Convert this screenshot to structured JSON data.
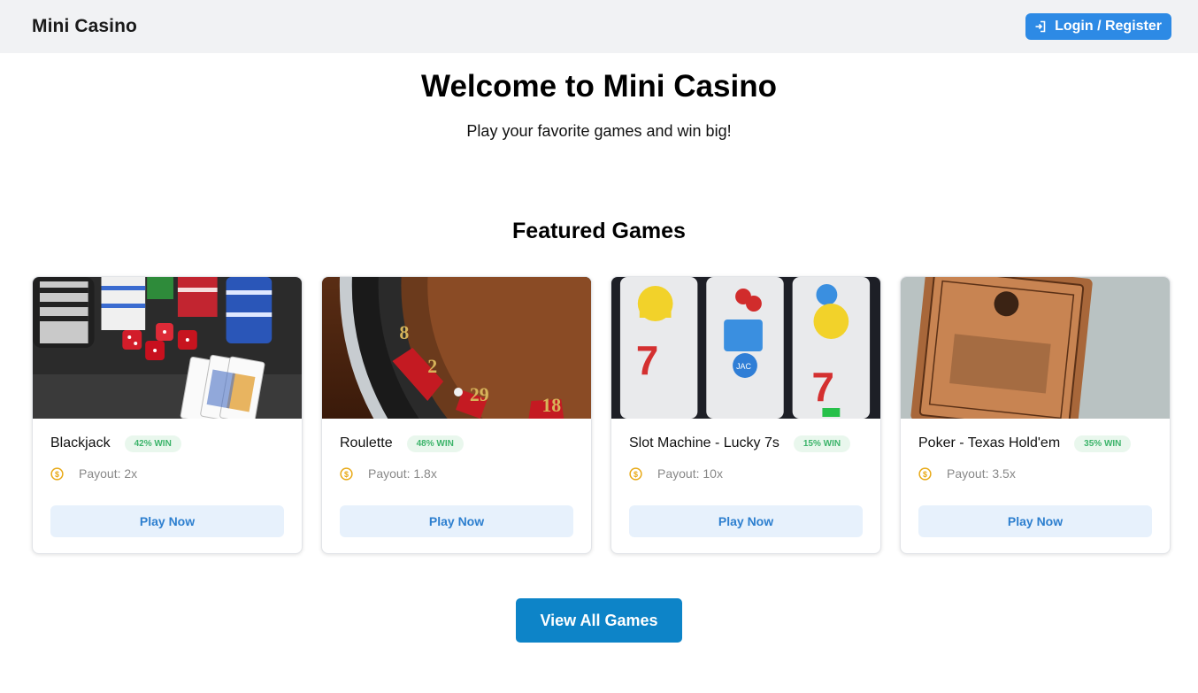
{
  "header": {
    "brand": "Mini Casino",
    "login_label": "Login / Register"
  },
  "hero": {
    "title": "Welcome to Mini Casino",
    "subtitle": "Play your favorite games and win big!"
  },
  "featured": {
    "title": "Featured Games",
    "games": [
      {
        "name": "Blackjack",
        "win": "42% WIN",
        "payout": "Payout: 2x",
        "play": "Play Now"
      },
      {
        "name": "Roulette",
        "win": "48% WIN",
        "payout": "Payout: 1.8x",
        "play": "Play Now"
      },
      {
        "name": "Slot Machine - Lucky 7s",
        "win": "15% WIN",
        "payout": "Payout: 10x",
        "play": "Play Now"
      },
      {
        "name": "Poker - Texas Hold'em",
        "win": "35% WIN",
        "payout": "Payout: 3.5x",
        "play": "Play Now"
      }
    ]
  },
  "view_all_label": "View All Games",
  "colors": {
    "primary": "#2d8ae5",
    "view_all": "#0d84c8",
    "win_badge_text": "#3cb46a",
    "coin": "#e8a916"
  },
  "icons": {
    "login": "sign-in-icon",
    "payout": "coin-dollar-icon"
  }
}
